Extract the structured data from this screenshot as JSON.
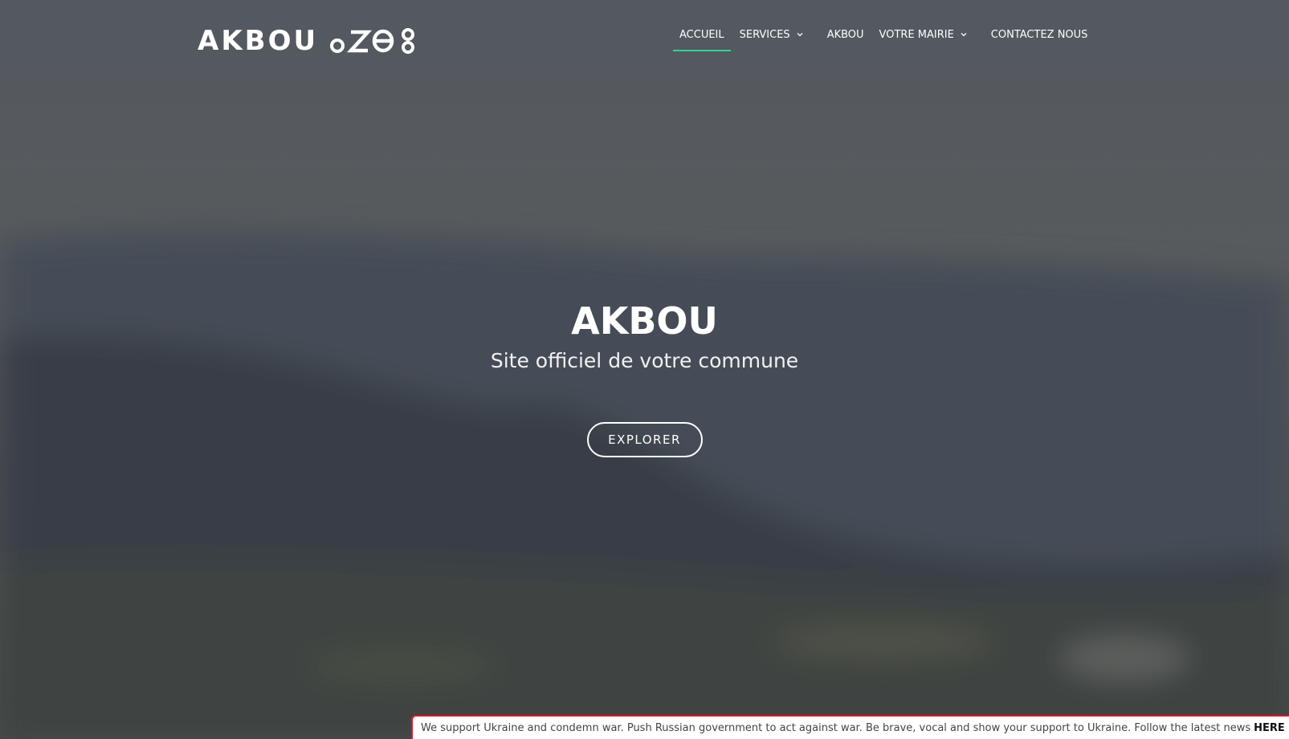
{
  "site": {
    "logo_text": "AKBOU"
  },
  "nav": {
    "items": [
      {
        "label": "ACCUEIL",
        "active": true,
        "has_dropdown": false
      },
      {
        "label": "SERVICES",
        "active": false,
        "has_dropdown": true
      },
      {
        "label": "AKBOU",
        "active": false,
        "has_dropdown": false
      },
      {
        "label": "VOTRE MAIRIE",
        "active": false,
        "has_dropdown": true
      },
      {
        "label": "CONTACTEZ NOUS",
        "active": false,
        "has_dropdown": false
      }
    ]
  },
  "hero": {
    "title": "AKBOU",
    "subtitle": "Site officiel de votre commune",
    "button_label": "EXPLORER"
  },
  "banner": {
    "text": "We support Ukraine and condemn war. Push Russian government to act against war. Be brave, vocal and show your support to Ukraine. Follow the latest news",
    "link_label": "HERE"
  },
  "colors": {
    "active_underline": "#2ed3a0",
    "banner_border": "#e0142c",
    "overlay": "#50565d"
  },
  "icons": {
    "logo_glyphs": "tifinagh-glyphs-icon",
    "dropdown": "chevron-down-icon"
  }
}
